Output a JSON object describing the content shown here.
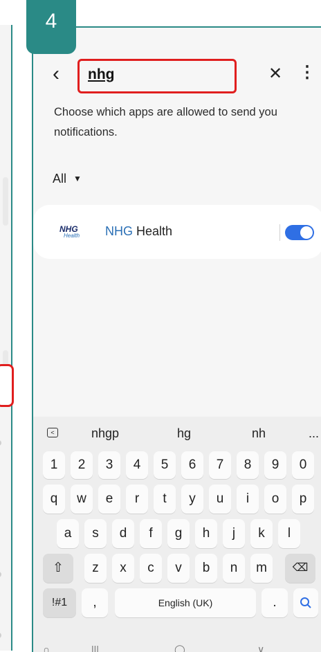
{
  "step_number": "4",
  "header": {
    "back_icon": "chevron-left-icon",
    "search_value": "nhg",
    "clear_icon": "close-icon",
    "more_icon": "more-vertical-icon"
  },
  "description": "Choose which apps are allowed to send you notifications.",
  "filter": {
    "label": "All"
  },
  "apps": [
    {
      "logo_text": "NHG",
      "logo_sub": "Health",
      "name_match": "NHG",
      "name_rest": " Health",
      "enabled": true
    }
  ],
  "keyboard": {
    "suggestions": [
      "nhgp",
      "hg",
      "nh",
      "..."
    ],
    "row_numbers": [
      "1",
      "2",
      "3",
      "4",
      "5",
      "6",
      "7",
      "8",
      "9",
      "0"
    ],
    "row1": [
      "q",
      "w",
      "e",
      "r",
      "t",
      "y",
      "u",
      "i",
      "o",
      "p"
    ],
    "row2": [
      "a",
      "s",
      "d",
      "f",
      "g",
      "h",
      "j",
      "k",
      "l"
    ],
    "row3": [
      "z",
      "x",
      "c",
      "v",
      "b",
      "n",
      "m"
    ],
    "symbols_key": "!#1",
    "comma_key": ",",
    "space_label": "English (UK)",
    "period_key": ".",
    "shift_icon": "shift-icon",
    "backspace_icon": "backspace-icon",
    "search_icon": "search-icon"
  },
  "colors": {
    "accent": "#2a8a86",
    "highlight": "#e01e1e",
    "toggle_on": "#2f6fe4"
  }
}
